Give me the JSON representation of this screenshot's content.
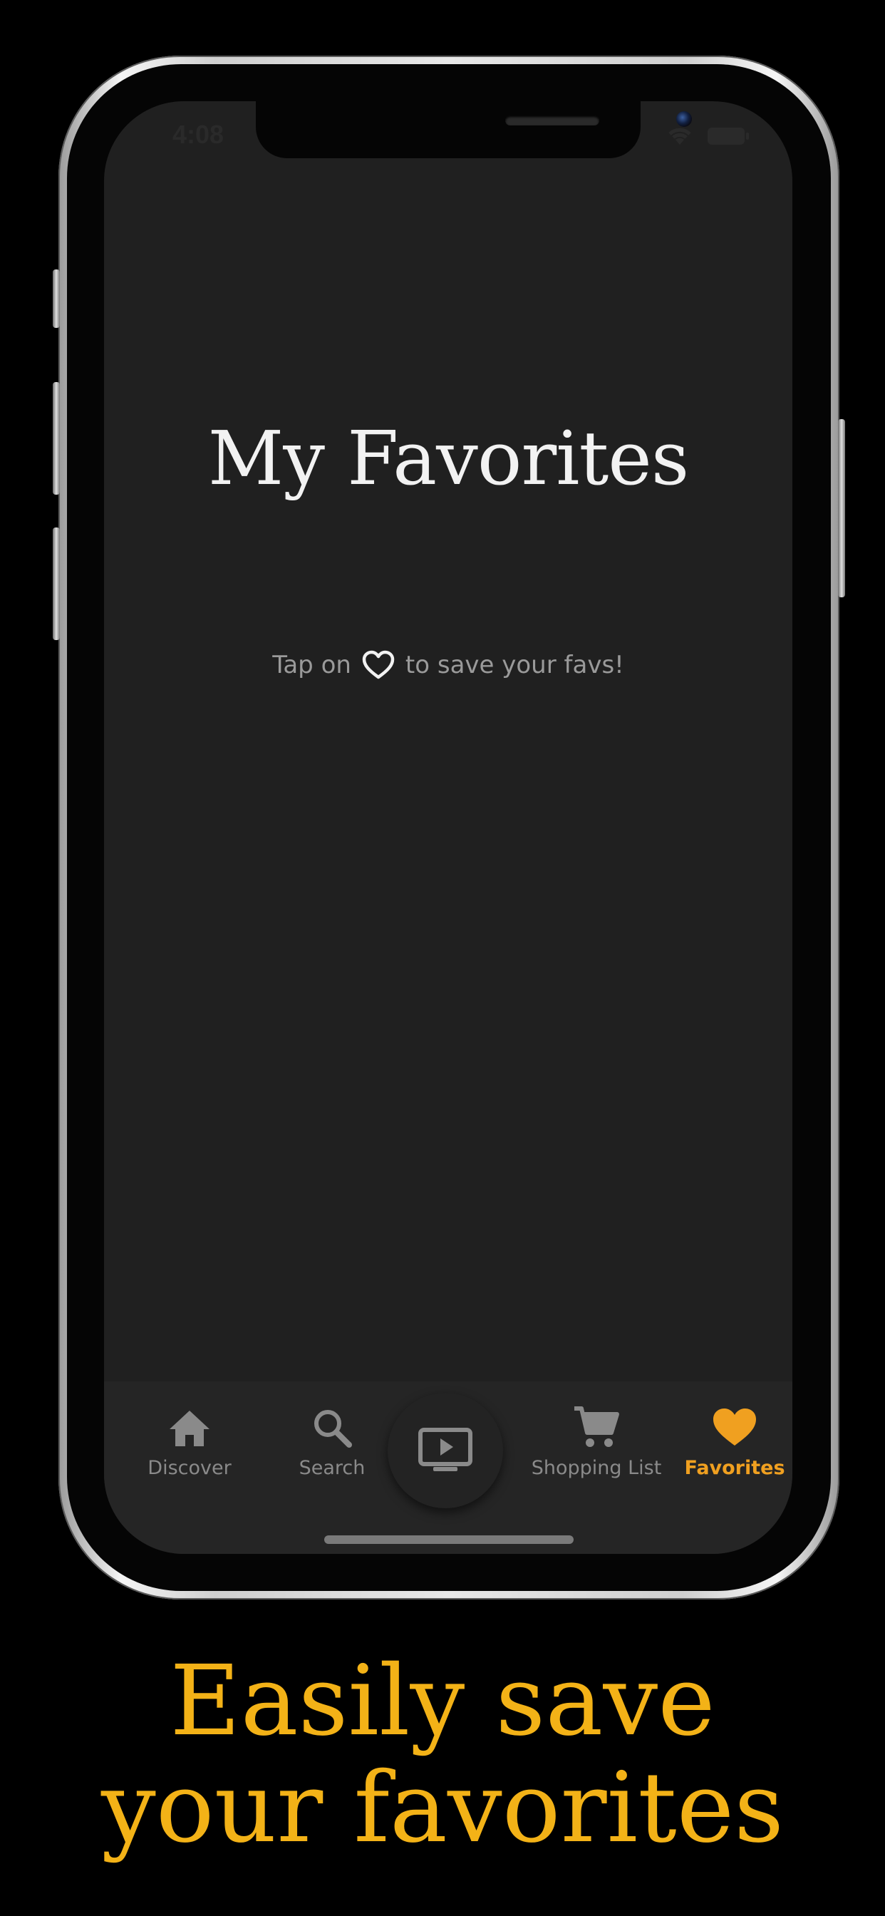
{
  "status_bar": {
    "time": "4:08",
    "icons": [
      "wifi-icon",
      "battery-icon"
    ]
  },
  "screen": {
    "title": "My Favorites",
    "hint_before": "Tap on",
    "hint_icon": "heart-outline-icon",
    "hint_after": "to save your favs!"
  },
  "tab_bar": {
    "tabs": [
      {
        "label": "Discover",
        "icon": "home-icon",
        "active": false
      },
      {
        "label": "Search",
        "icon": "search-icon",
        "active": false
      },
      {
        "label": "Shopping List",
        "icon": "cart-icon",
        "active": false
      },
      {
        "label": "Favorites",
        "icon": "heart-icon",
        "active": true
      }
    ],
    "center_icon": "play-screen-icon"
  },
  "caption": {
    "line1": "Easily save",
    "line2": "your favorites"
  },
  "colors": {
    "background": "#000000",
    "screen": "#202020",
    "tab_bar": "#252525",
    "accent": "#f0a020",
    "caption": "#f3b217",
    "title": "#f2f2f2",
    "muted": "#8a8a8a"
  }
}
